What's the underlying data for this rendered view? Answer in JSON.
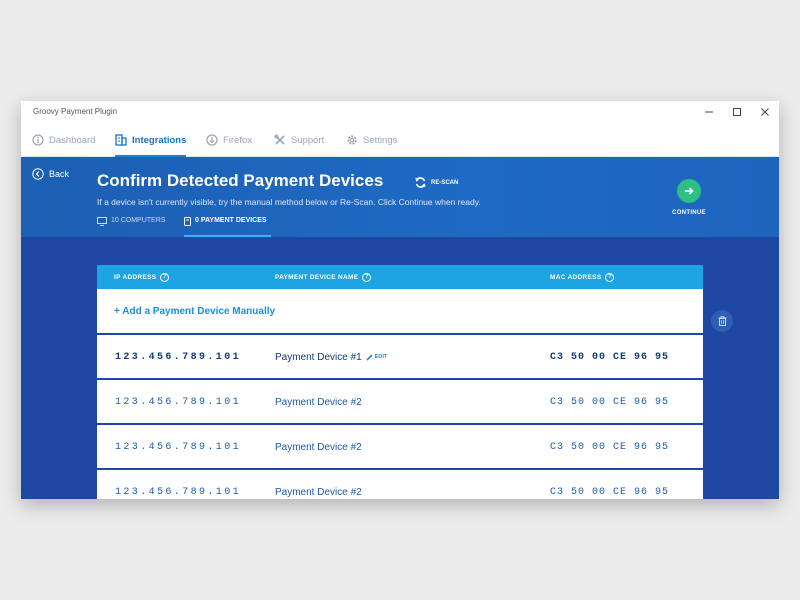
{
  "window": {
    "title": "Groovy Payment Plugin"
  },
  "nav": {
    "tabs": [
      {
        "label": "Dashboard",
        "icon": "info-icon"
      },
      {
        "label": "Integrations",
        "icon": "building-icon"
      },
      {
        "label": "Firefox",
        "icon": "download-icon"
      },
      {
        "label": "Support",
        "icon": "tools-icon"
      },
      {
        "label": "Settings",
        "icon": "gear-icon"
      }
    ],
    "active": "Integrations"
  },
  "header": {
    "back_label": "Back",
    "title": "Confirm Detected Payment Devices",
    "rescan_label": "RE-SCAN",
    "subtitle": "If a device isn't currently visible, try the manual method below or Re-Scan. Click Continue when ready.",
    "subtabs": [
      {
        "label": "10 COMPUTERS",
        "icon": "monitor-icon"
      },
      {
        "label": "0 PAYMENT DEVICES",
        "icon": "card-reader-icon"
      }
    ],
    "continue_label": "CONTINUE"
  },
  "table": {
    "columns": [
      "IP ADDRESS",
      "PAYMENT DEVICE NAME",
      "MAC ADDRESS"
    ],
    "add_label": "+ Add a Payment Device Manually",
    "edit_label": "EDIT",
    "rows": [
      {
        "ip": "123.456.789.101",
        "name": "Payment Device #1",
        "mac": "C3 50 00 CE 96 95"
      },
      {
        "ip": "123.456.789.101",
        "name": "Payment Device #2",
        "mac": "C3 50 00 CE 96 95"
      },
      {
        "ip": "123.456.789.101",
        "name": "Payment Device #2",
        "mac": "C3 50 00 CE 96 95"
      },
      {
        "ip": "123.456.789.101",
        "name": "Payment Device #2",
        "mac": "C3 50 00 CE 96 95"
      }
    ]
  },
  "colors": {
    "accent": "#1da4e3",
    "header_bg": "#1f6ac4",
    "content_bg": "#1d47a0",
    "continue": "#2fbe83"
  }
}
